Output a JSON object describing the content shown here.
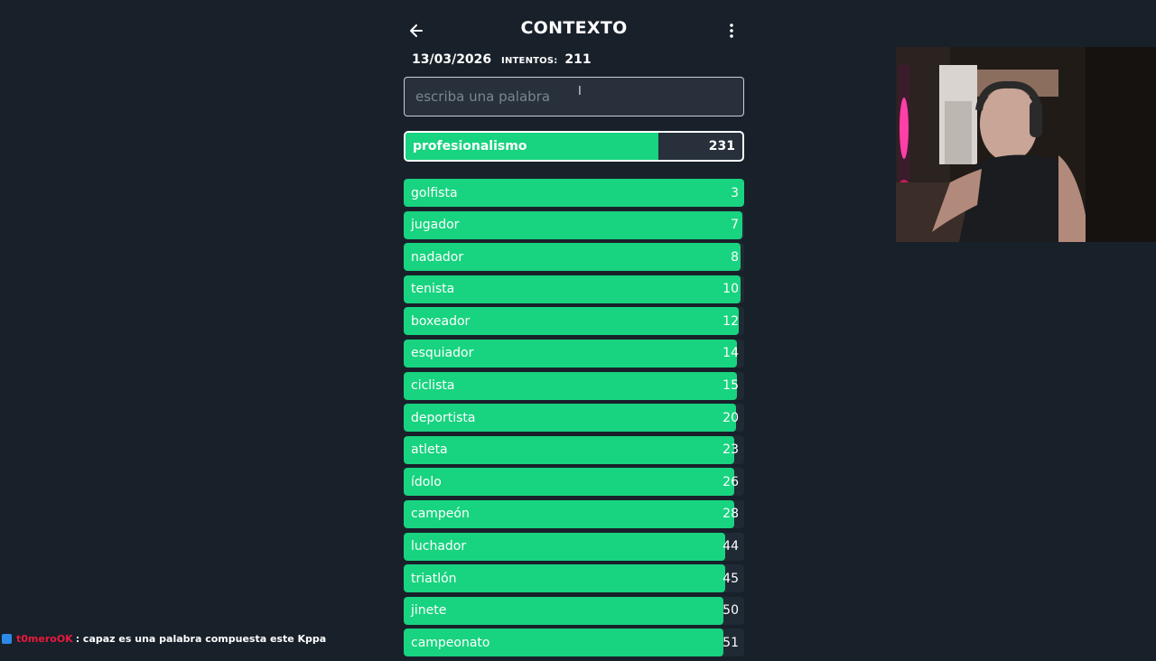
{
  "header": {
    "title": "CONTEXTO",
    "date": "13/03/2026",
    "attempts_label": "INTENTOS:",
    "attempts_value": "211"
  },
  "search": {
    "placeholder": "escriba una palabra"
  },
  "current_guess": {
    "word": "profesionalismo",
    "rank": "231",
    "fill_fraction": 0.75
  },
  "guesses": [
    {
      "word": "golfista",
      "rank": "3",
      "fill_fraction": 1.0
    },
    {
      "word": "jugador",
      "rank": "7",
      "fill_fraction": 0.995
    },
    {
      "word": "nadador",
      "rank": "8",
      "fill_fraction": 0.99
    },
    {
      "word": "tenista",
      "rank": "10",
      "fill_fraction": 0.99
    },
    {
      "word": "boxeador",
      "rank": "12",
      "fill_fraction": 0.985
    },
    {
      "word": "esquiador",
      "rank": "14",
      "fill_fraction": 0.98
    },
    {
      "word": "ciclista",
      "rank": "15",
      "fill_fraction": 0.98
    },
    {
      "word": "deportista",
      "rank": "20",
      "fill_fraction": 0.975
    },
    {
      "word": "atleta",
      "rank": "23",
      "fill_fraction": 0.97
    },
    {
      "word": "ídolo",
      "rank": "26",
      "fill_fraction": 0.97
    },
    {
      "word": "campeón",
      "rank": "28",
      "fill_fraction": 0.97
    },
    {
      "word": "luchador",
      "rank": "44",
      "fill_fraction": 0.945
    },
    {
      "word": "triatlón",
      "rank": "45",
      "fill_fraction": 0.945
    },
    {
      "word": "jinete",
      "rank": "50",
      "fill_fraction": 0.94
    },
    {
      "word": "campeonato",
      "rank": "51",
      "fill_fraction": 0.94
    }
  ],
  "chat": {
    "username": "t0meroOK",
    "message": ": capaz es una palabra compuesta este Kppa"
  },
  "colors": {
    "background": "#18202a",
    "bar_green": "#18d37f",
    "bar_track": "#202a35",
    "chat_user": "#e8193c"
  },
  "icons": {
    "back": "arrow-left-icon",
    "menu": "kebab-menu-icon",
    "chat_badge": "bot-badge-icon"
  }
}
